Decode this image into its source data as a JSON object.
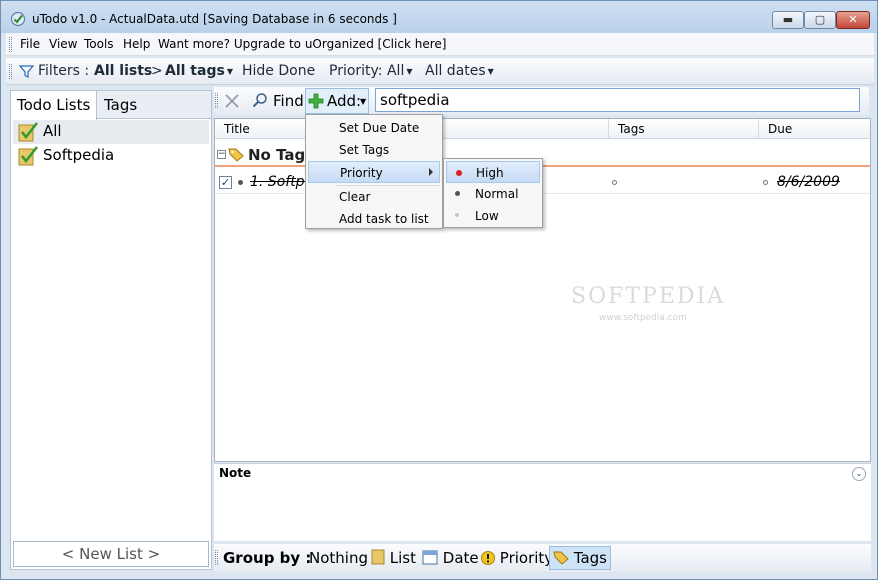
{
  "window": {
    "title": "uTodo v1.0 - ActualData.utd  [Saving Database in 6 seconds ]",
    "min_glyph": "▬",
    "max_glyph": "▢",
    "close_glyph": "✕"
  },
  "menubar": {
    "items": [
      "File",
      "View",
      "Tools",
      "Help",
      "Want more? Upgrade to uOrganized [Click here]"
    ]
  },
  "filterbar": {
    "filters_label": "Filters :",
    "lists_value": "All lists",
    "separator": ">",
    "tags_value": "All tags",
    "hide_done": "Hide Done",
    "priority": "Priority: All",
    "dates": "All dates"
  },
  "leftpanel": {
    "tabs": [
      "Todo Lists",
      "Tags"
    ],
    "lists": [
      "All",
      "Softpedia"
    ],
    "new_list": "< New List >"
  },
  "findbar": {
    "find_label": "Find",
    "add_label": "Add:",
    "search_value": "softpedia"
  },
  "grid": {
    "columns": [
      "Title",
      "Tags",
      "Due"
    ],
    "group_label": "No Tags",
    "rows": [
      {
        "title": "1. Softpe",
        "checked_glyph": "✓",
        "tags": "",
        "due": "8/6/2009"
      }
    ],
    "watermark": "SOFTPEDIA",
    "watermark_url": "www.softpedia.com"
  },
  "note": {
    "title": "Note",
    "collapse_glyph": "⌄"
  },
  "groupbar": {
    "label": "Group by :",
    "options": [
      "Nothing",
      "List",
      "Date",
      "Priority",
      "Tags"
    ],
    "active": "Tags"
  },
  "context_menu": {
    "items": [
      "Set Due Date",
      "Set Tags",
      "Priority",
      "Clear",
      "Add task to list"
    ],
    "highlighted": "Priority"
  },
  "priority_submenu": {
    "items": [
      {
        "label": "High",
        "color": "#e02020"
      },
      {
        "label": "Normal",
        "color": "#555555"
      },
      {
        "label": "Low",
        "color": "#c8c8c8"
      }
    ],
    "highlighted": "High"
  },
  "colors": {
    "accent": "#7aa5d6",
    "group_underline": "#f1a27a",
    "window_frame": "#dbe6f1"
  }
}
